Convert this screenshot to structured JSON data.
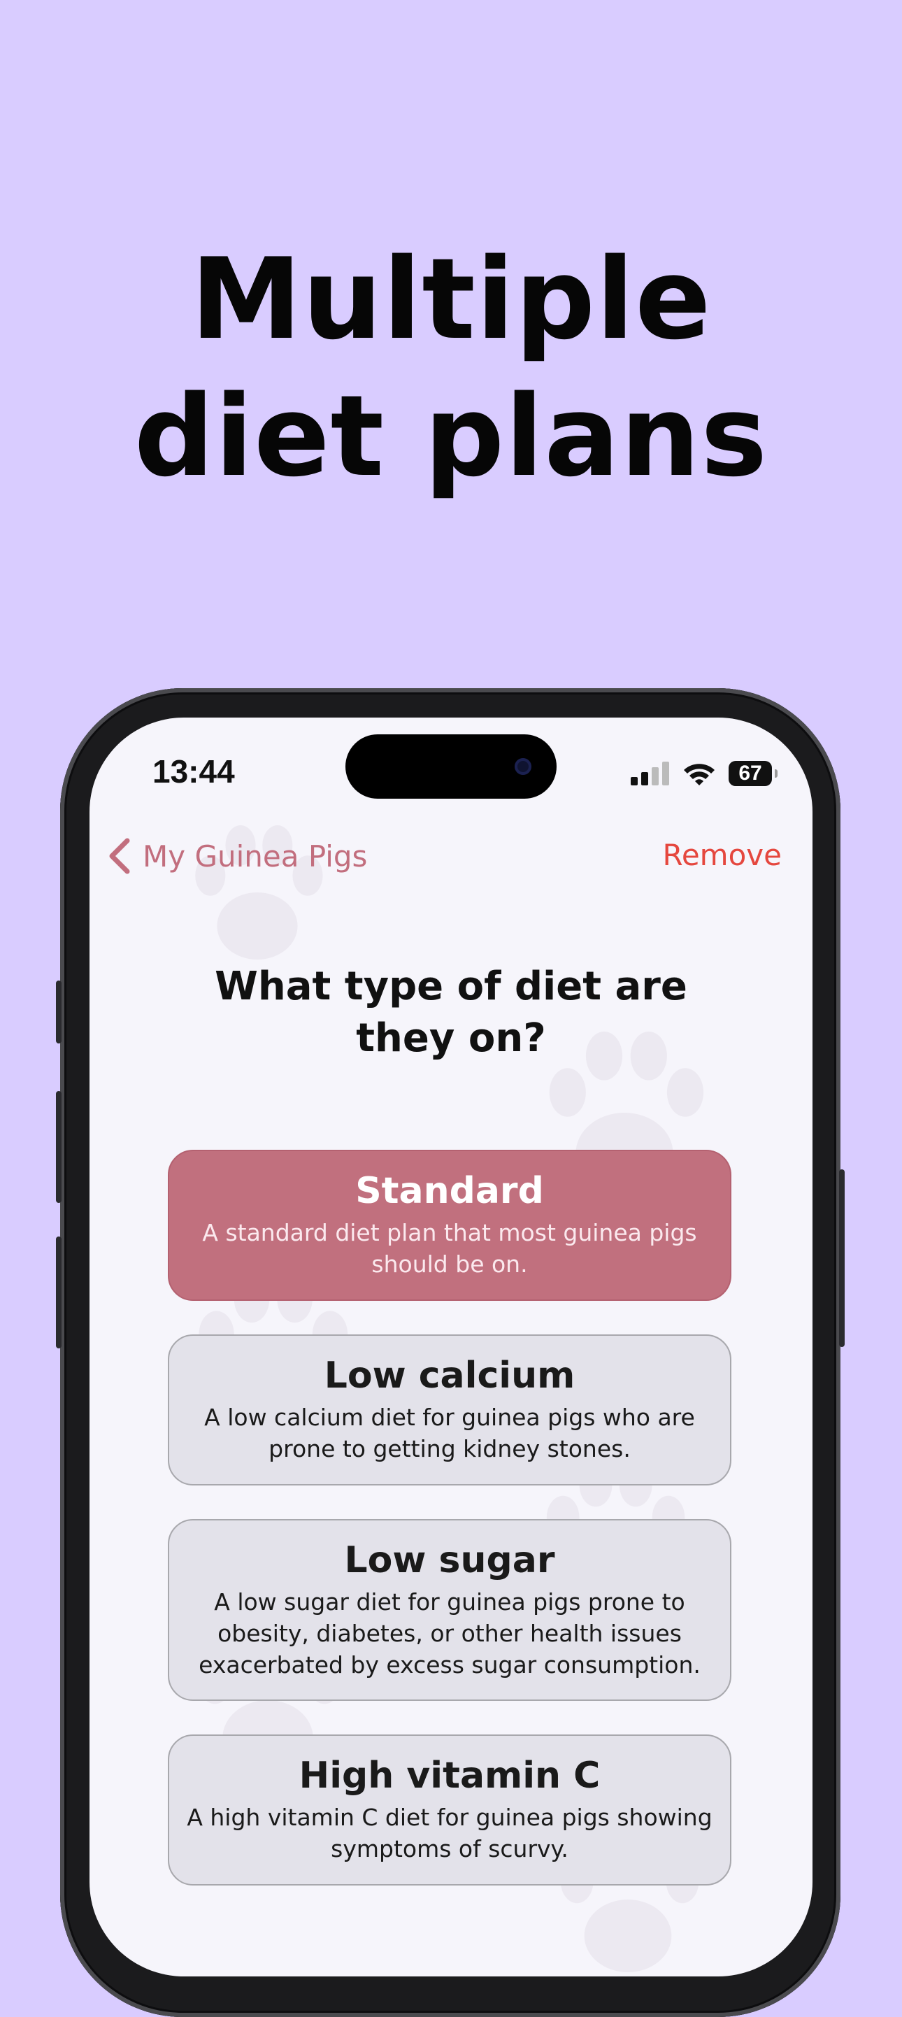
{
  "headline": {
    "line1": "Multiple",
    "line2": "diet plans"
  },
  "status_bar": {
    "time": "13:44",
    "battery": "67"
  },
  "nav": {
    "back_label": "My Guinea Pigs",
    "remove_label": "Remove"
  },
  "question": {
    "line1": "What type of diet are",
    "line2": "they on?"
  },
  "options": [
    {
      "title": "Standard",
      "description": "A standard diet plan that most guinea pigs should be on.",
      "selected": true
    },
    {
      "title": "Low calcium",
      "description": "A low calcium diet for guinea pigs who are prone to getting kidney stones.",
      "selected": false
    },
    {
      "title": "Low sugar",
      "description": "A low sugar diet for guinea pigs prone to obesity, diabetes, or other health issues exacerbated by excess sugar consumption.",
      "selected": false
    },
    {
      "title": "High vitamin C",
      "description": "A high vitamin C diet for guinea pigs showing symptoms of scurvy.",
      "selected": false
    }
  ],
  "colors": {
    "background": "#d9ccff",
    "accent": "#c1707e",
    "destructive": "#e5473e",
    "card": "#e3e2ea"
  }
}
